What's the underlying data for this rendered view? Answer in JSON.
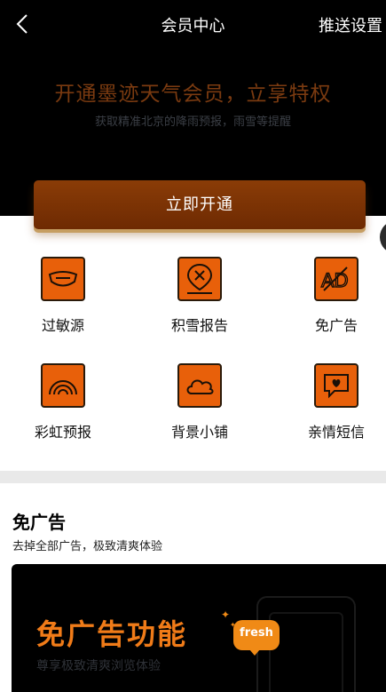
{
  "nav": {
    "title": "会员中心",
    "push_settings": "推送设置"
  },
  "hero": {
    "title": "开通墨迹天气会员，立享特权",
    "subtitle": "获取精准北京的降雨预报，雨雪等提醒"
  },
  "cta": {
    "label": "立即开通"
  },
  "features": [
    {
      "label": "过敏源",
      "icon": "mask-icon"
    },
    {
      "label": "积雪报告",
      "icon": "snow-location-icon"
    },
    {
      "label": "免广告",
      "icon": "ad-block-icon"
    },
    {
      "label": "彩虹预报",
      "icon": "rainbow-icon"
    },
    {
      "label": "背景小铺",
      "icon": "cloud-icon"
    },
    {
      "label": "亲情短信",
      "icon": "heart-message-icon"
    }
  ],
  "section": {
    "title": "免广告",
    "subtitle": "去掉全部广告，极致清爽体验"
  },
  "promo": {
    "title": "免广告功能",
    "subtitle": "尊享极致清爽浏览体验",
    "badge": "fresh"
  },
  "colors": {
    "accent": "#e8600a",
    "button": "#7a3205",
    "header_bg": "#000000"
  }
}
